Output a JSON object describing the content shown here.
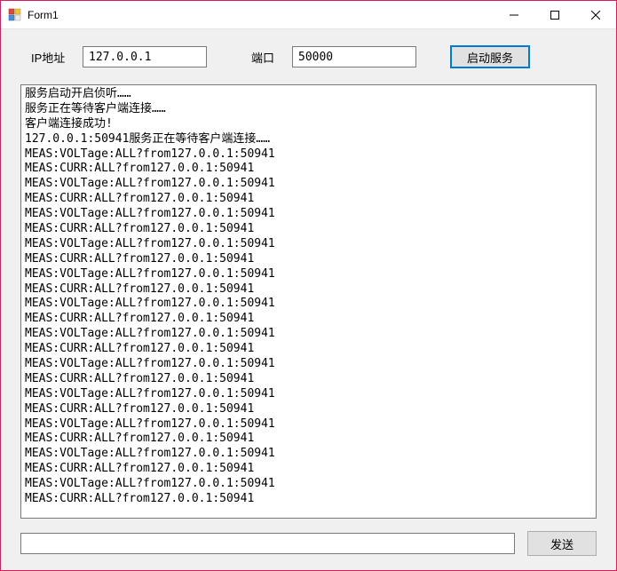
{
  "window": {
    "title": "Form1"
  },
  "form": {
    "ip_label": "IP地址",
    "ip_value": "127.0.0.1",
    "port_label": "端口",
    "port_value": "50000",
    "start_button": "启动服务",
    "send_button": "发送",
    "send_value": ""
  },
  "log_lines": [
    "服务启动开启侦听……",
    "服务正在等待客户端连接……",
    "客户端连接成功!",
    "127.0.0.1:50941服务正在等待客户端连接……",
    "MEAS:VOLTage:ALL?from127.0.0.1:50941",
    "MEAS:CURR:ALL?from127.0.0.1:50941",
    "MEAS:VOLTage:ALL?from127.0.0.1:50941",
    "MEAS:CURR:ALL?from127.0.0.1:50941",
    "MEAS:VOLTage:ALL?from127.0.0.1:50941",
    "MEAS:CURR:ALL?from127.0.0.1:50941",
    "MEAS:VOLTage:ALL?from127.0.0.1:50941",
    "MEAS:CURR:ALL?from127.0.0.1:50941",
    "MEAS:VOLTage:ALL?from127.0.0.1:50941",
    "MEAS:CURR:ALL?from127.0.0.1:50941",
    "MEAS:VOLTage:ALL?from127.0.0.1:50941",
    "MEAS:CURR:ALL?from127.0.0.1:50941",
    "MEAS:VOLTage:ALL?from127.0.0.1:50941",
    "MEAS:CURR:ALL?from127.0.0.1:50941",
    "MEAS:VOLTage:ALL?from127.0.0.1:50941",
    "MEAS:CURR:ALL?from127.0.0.1:50941",
    "MEAS:VOLTage:ALL?from127.0.0.1:50941",
    "MEAS:CURR:ALL?from127.0.0.1:50941",
    "MEAS:VOLTage:ALL?from127.0.0.1:50941",
    "MEAS:CURR:ALL?from127.0.0.1:50941",
    "MEAS:VOLTage:ALL?from127.0.0.1:50941",
    "MEAS:CURR:ALL?from127.0.0.1:50941",
    "MEAS:VOLTage:ALL?from127.0.0.1:50941",
    "MEAS:CURR:ALL?from127.0.0.1:50941"
  ]
}
